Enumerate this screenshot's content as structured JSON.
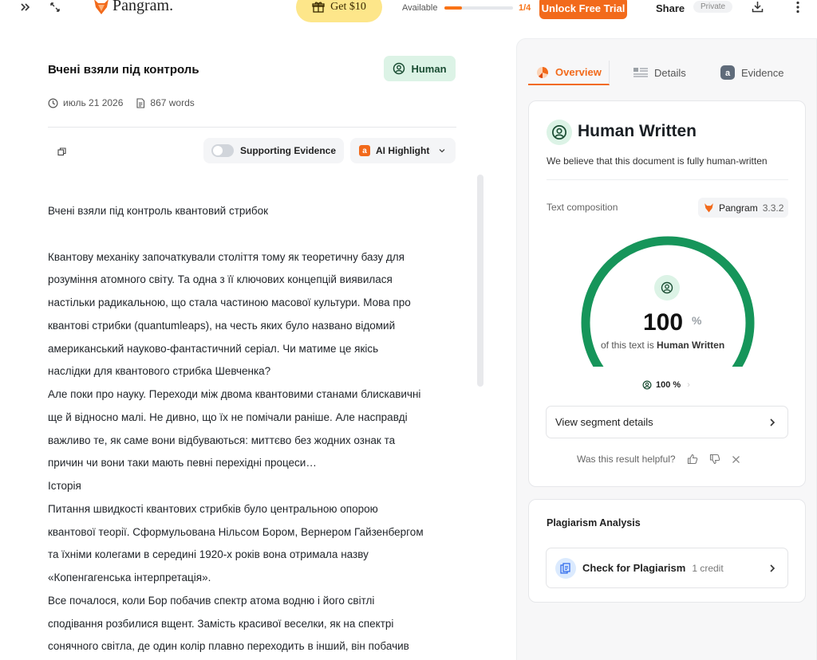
{
  "topbar": {
    "logo_text": "Pangram.",
    "gift_label": "Get $10",
    "available_label": "Available",
    "available_count": "1/4",
    "available_fraction": 0.25,
    "unlock_label": "Unlock Free Trial",
    "share_label": "Share",
    "private_label": "Private"
  },
  "document": {
    "title": "Вчені взяли під контроль",
    "badge_label": "Human",
    "date": "июль 21 2026",
    "words": "867 words",
    "evidence_label": "Supporting Evidence",
    "ai_highlight_label": "AI Highlight",
    "ai_highlight_glyph": "a",
    "paragraphs": [
      "Вчені взяли під контроль квантовий стрибок",
      "",
      "Квантову механіку започаткували століття тому як теоретичну базу для",
      "розуміння атомного світу. Та одна з її ключових концепцій виявилася",
      "настільки радикальною, що стала частиною масової культури. Мова про",
      "квантові стрибки (quantumleaps), на честь яких було названо відомий",
      "американський науково-фантастичний серіал. Чи матиме це якісь",
      "наслідки для квантового стрибка Шевченка?",
      "Але поки про науку. Переходи між двома квантовими станами блискавичні",
      "ще й відносно малі. Не дивно, що їх не помічали раніше. Але насправді",
      "важливо те, як саме вони відбуваються: миттєво без жодних ознак та",
      "причин чи вони таки мають певні перехідні процеси…",
      "Історія",
      "Питання швидкості квантових стрибків було центральною опорою",
      "квантової теорії. Сформульована Нільсом Бором, Вернером Гайзенбергом",
      "та їхніми колегами в середині 1920-х років вона отримала назву",
      "«Копенгагенська інтерпретація».",
      "Все почалося, коли Бор побачив спектр атома водню і його світлі",
      "сподівання розбилися вщент. Замість красивої веселки, як на спектрі",
      "сонячного світла, де один колір плавно переходить в інший, він побачив"
    ]
  },
  "panel": {
    "tabs": [
      {
        "label": "Overview",
        "icon": "pie-chart-icon",
        "active": true
      },
      {
        "label": "Details",
        "icon": "list-icon",
        "active": false
      },
      {
        "label": "Evidence",
        "icon": "evidence-icon",
        "active": false
      }
    ],
    "result": {
      "title": "Human Written",
      "description": "We believe that this document is fully human-written",
      "composition_label": "Text composition",
      "model_name": "Pangram",
      "model_version": "3.3.2",
      "gauge_value": "100",
      "gauge_fraction": 1.0,
      "gauge_unit": "%",
      "caption_prefix": "of this text is ",
      "caption_strong": "Human Written",
      "segment_pct": "100 %",
      "segment_chevron": "›",
      "view_segments_label": "View segment details",
      "helpful_label": "Was this result helpful?"
    },
    "plagiarism": {
      "title": "Plagiarism Analysis",
      "check_label": "Check for Plagiarism",
      "credit_label": "1 credit"
    }
  },
  "colors": {
    "accent": "#f26a1b",
    "human_green": "#1a9a5a",
    "badge_bg": "#dcf3e6"
  }
}
